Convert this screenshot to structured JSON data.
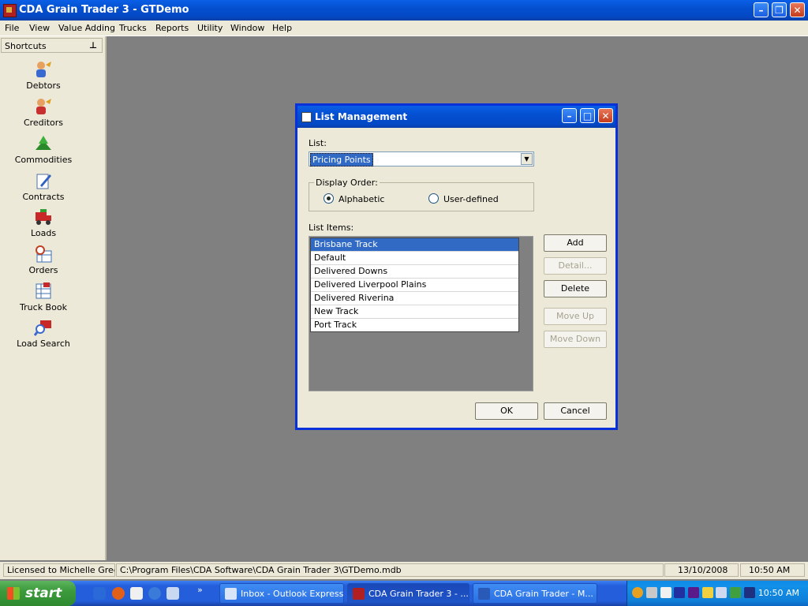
{
  "window": {
    "title": "CDA Grain Trader 3 - GTDemo"
  },
  "menu": [
    "File",
    "View",
    "Value Adding",
    "Trucks",
    "Reports",
    "Utility",
    "Window",
    "Help"
  ],
  "shortcuts": {
    "header": "Shortcuts",
    "items": [
      {
        "label": "Debtors",
        "icon": "debtors-icon"
      },
      {
        "label": "Creditors",
        "icon": "creditors-icon"
      },
      {
        "label": "Commodities",
        "icon": "commodities-icon"
      },
      {
        "label": "Contracts",
        "icon": "contracts-icon"
      },
      {
        "label": "Loads",
        "icon": "loads-icon"
      },
      {
        "label": "Orders",
        "icon": "orders-icon"
      },
      {
        "label": "Truck Book",
        "icon": "truck-book-icon"
      },
      {
        "label": "Load Search",
        "icon": "load-search-icon"
      }
    ]
  },
  "dialog": {
    "title": "List Management",
    "list_label": "List:",
    "list_value": "Pricing Points",
    "display_order_label": "Display Order:",
    "radio_alphabetic": "Alphabetic",
    "radio_user_defined": "User-defined",
    "selected_order": "Alphabetic",
    "list_items_label": "List Items:",
    "items": [
      "Brisbane Track",
      "Default",
      "Delivered Downs",
      "Delivered Liverpool Plains",
      "Delivered Riverina",
      "New Track",
      "Port Track"
    ],
    "selected_item": "Brisbane Track",
    "buttons": {
      "add": "Add",
      "detail": "Detail...",
      "delete": "Delete",
      "move_up": "Move Up",
      "move_down": "Move Down",
      "ok": "OK",
      "cancel": "Cancel"
    }
  },
  "status": {
    "licensed": "Licensed to Michelle Greer",
    "path": "C:\\Program Files\\CDA Software\\CDA Grain Trader 3\\GTDemo.mdb",
    "date": "13/10/2008",
    "time": "10:50 AM"
  },
  "taskbar": {
    "start_label": "start",
    "tasks": [
      "Inbox - Outlook Express",
      "CDA Grain Trader 3 - ...",
      "CDA Grain Trader - M..."
    ],
    "active_task": "CDA Grain Trader 3 - ...",
    "clock": "10:50 AM"
  },
  "colors": {
    "title_blue": "#0450d2",
    "selection": "#316ac5",
    "face": "#ece9d8",
    "mdi": "#808080"
  }
}
